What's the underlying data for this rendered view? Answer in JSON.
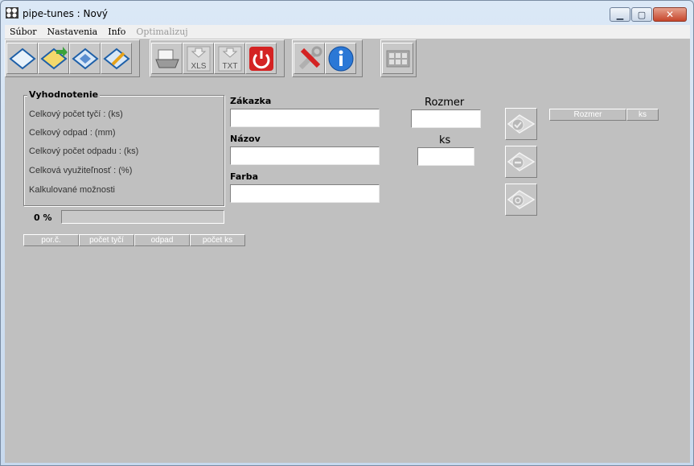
{
  "window": {
    "title": "pipe-tunes : Nový",
    "buttons": {
      "minimize_icon": "minimize-icon",
      "maximize_icon": "maximize-icon",
      "close_icon": "close-icon"
    }
  },
  "menu": {
    "items": [
      {
        "label": "Súbor",
        "enabled": true
      },
      {
        "label": "Nastavenia",
        "enabled": true
      },
      {
        "label": "Info",
        "enabled": true
      },
      {
        "label": "Optimalizuj",
        "enabled": false
      }
    ]
  },
  "toolbar": {
    "groups": [
      {
        "buttons": [
          {
            "icon": "new-document-icon",
            "label": ""
          },
          {
            "icon": "open-folder-icon",
            "label": ""
          },
          {
            "icon": "save-disk-icon",
            "label": ""
          },
          {
            "icon": "save-as-disk-icon",
            "label": ""
          }
        ]
      },
      {
        "buttons": [
          {
            "icon": "printer-icon",
            "label": ""
          },
          {
            "icon": "export-xls-icon",
            "label": "XLS"
          },
          {
            "icon": "export-txt-icon",
            "label": "TXT"
          },
          {
            "icon": "power-exit-icon",
            "label": ""
          }
        ]
      },
      {
        "buttons": [
          {
            "icon": "tools-settings-icon",
            "label": ""
          },
          {
            "icon": "info-icon",
            "label": ""
          }
        ]
      },
      {
        "buttons": [
          {
            "icon": "optimize-calculator-icon",
            "label": ""
          }
        ]
      }
    ]
  },
  "summary": {
    "title": "Vyhodnotenie",
    "stats": [
      "Celkový počet tyčí : (ks)",
      "Celkový odpad : (mm)",
      "Celkový počet odpadu : (ks)",
      "Celková využiteľnosť : (%)",
      "Kalkulované možnosti"
    ]
  },
  "progress": {
    "label": "0 %",
    "value": 0
  },
  "results_table": {
    "columns": [
      "por.č.",
      "počet tyčí",
      "odpad",
      "počet ks"
    ]
  },
  "order_form": {
    "zakazka_label": "Zákazka",
    "zakazka_value": "",
    "nazov_label": "Názov",
    "nazov_value": "",
    "farba_label": "Farba",
    "farba_value": ""
  },
  "dimension_form": {
    "rozmer_label": "Rozmer",
    "rozmer_value": "",
    "ks_label": "ks",
    "ks_value": ""
  },
  "action_buttons": [
    {
      "icon": "add-item-icon",
      "enabled": false
    },
    {
      "icon": "remove-item-icon",
      "enabled": false
    },
    {
      "icon": "edit-item-icon",
      "enabled": false
    }
  ],
  "items_table": {
    "columns": [
      "Rozmer",
      "ks"
    ]
  }
}
